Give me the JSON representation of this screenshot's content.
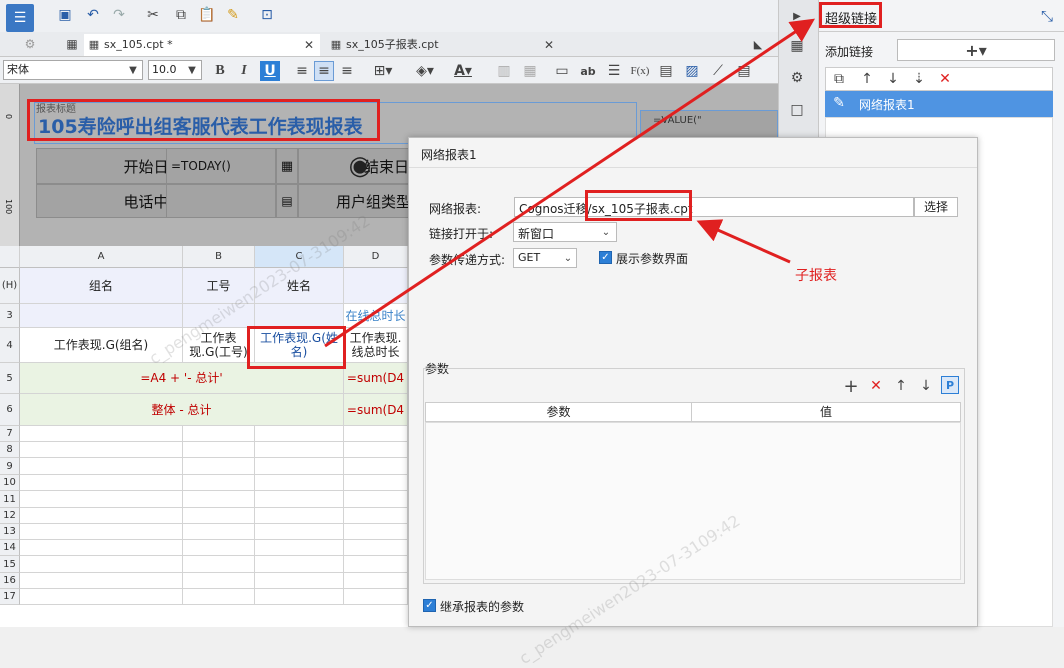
{
  "toolbar": {
    "tab1": "sx_105.cpt *",
    "tab2": "sx_105子报表.cpt",
    "font_name": "宋体",
    "font_size": "10.0"
  },
  "design": {
    "label": "报表标题",
    "title": "105寿险呼出组客服代表工作表现报表",
    "start_label": "开始日期:",
    "start_value": "=TODAY()",
    "end_label": "结束日",
    "center_label": "电话中心:",
    "usertype_label": "用户组类型",
    "value_label": "=VALUE(\""
  },
  "ruler": {
    "r1": "0",
    "r2": "100"
  },
  "grid": {
    "cols": [
      "A",
      "B",
      "C",
      "D"
    ],
    "rows": [
      "(H)",
      "3",
      "4",
      "5",
      "6",
      "7",
      "8",
      "9",
      "10",
      "11",
      "12",
      "13",
      "14",
      "15",
      "16",
      "17"
    ],
    "r_h": [
      "组名",
      "工号",
      "姓名"
    ],
    "r3_d": "在线总时长",
    "r4": [
      "工作表现.G(组名)",
      "工作表现.G(工号)",
      "工作表现.G(姓名)",
      "工作表现.线总时长"
    ],
    "r5_a": "=A4 + '- 总计'",
    "r5_d": "=sum(D4",
    "r6_a": "整体 - 总计",
    "r6_d": "=sum(D4"
  },
  "dialog": {
    "title": "网络报表1",
    "report_label": "网络报表:",
    "report_value": "Cognos迁移/sx_105子报表.cpt",
    "select_btn": "选择",
    "open_label": "链接打开于:",
    "open_value": "新窗口",
    "method_label": "参数传递方式:",
    "method_value": "GET",
    "show_param": "展示参数界面",
    "params_label": "参数",
    "col_param": "参数",
    "col_value": "值",
    "inherit": "继承报表的参数"
  },
  "panel": {
    "title": "超级链接",
    "add_label": "添加链接",
    "item": "网络报表1"
  },
  "annotation": {
    "sub": "子报表"
  },
  "watermark": "c_pengmeiwen2023-07-3109:42",
  "colors": {
    "red": "#e02020",
    "blue": "#2d7fd6",
    "formula": "#c00000",
    "grid_green": "#eaf3e3",
    "grid_lav": "#eef0fb"
  }
}
